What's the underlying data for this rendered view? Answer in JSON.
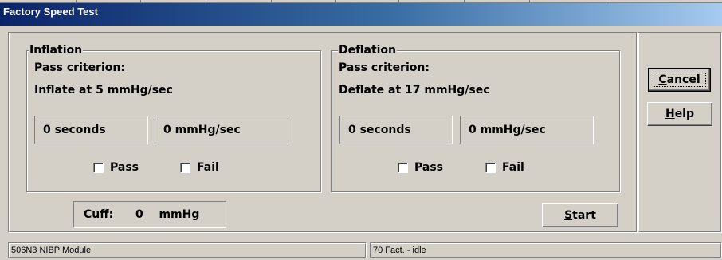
{
  "window": {
    "title": "Factory Speed Test"
  },
  "inflation": {
    "legend": "Inflation",
    "criterion_label": "Pass criterion:",
    "criterion_value": "Inflate at 5 mmHg/sec",
    "seconds": "0 seconds",
    "rate": "0 mmHg/sec",
    "pass_label": "Pass",
    "fail_label": "Fail",
    "pass_checked": false,
    "fail_checked": false
  },
  "deflation": {
    "legend": "Deflation",
    "criterion_label": "Pass criterion:",
    "criterion_value": "Deflate at 17 mmHg/sec",
    "seconds": "0 seconds",
    "rate": "0 mmHg/sec",
    "pass_label": "Pass",
    "fail_label": "Fail",
    "pass_checked": false,
    "fail_checked": false
  },
  "cuff": {
    "label": "Cuff:",
    "value": "0",
    "unit": "mmHg"
  },
  "buttons": {
    "start": {
      "mnemonic": "S",
      "rest": "tart"
    },
    "cancel": {
      "mnemonic": "C",
      "rest": "ancel"
    },
    "help": {
      "mnemonic": "H",
      "rest": "elp"
    }
  },
  "statusbar": {
    "left": "506N3 NIBP Module",
    "right": "70 Fact. - idle"
  },
  "colors": {
    "face": "#d4d0c8",
    "title_start": "#0a246a",
    "title_end": "#a6caf0"
  }
}
